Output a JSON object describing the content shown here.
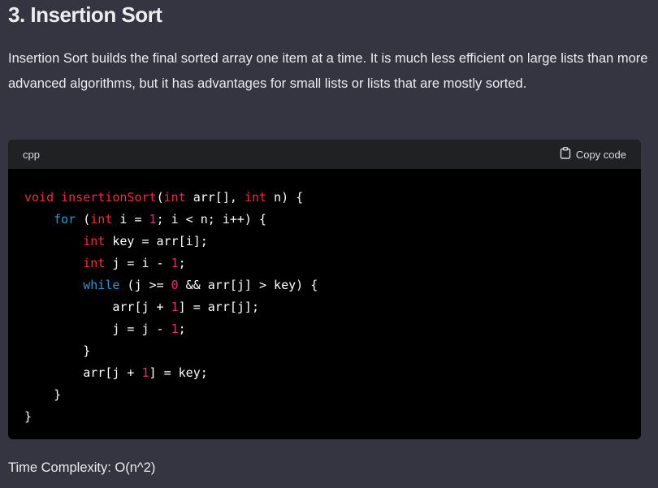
{
  "heading": "3. Insertion Sort",
  "paragraph": "Insertion Sort builds the final sorted array one item at a time. It is much less efficient on large lists than more advanced algorithms, but it has advantages for small lists or lists that are mostly sorted.",
  "code_block": {
    "language": "cpp",
    "copy_label": "Copy code",
    "copy_icon": "clipboard-icon",
    "colors": {
      "keyword": "#2e95d3",
      "type": "#f22c3d",
      "function": "#f22c3d",
      "number": "#df3079",
      "text": "#ffffff",
      "background": "#000000",
      "header_background": "#202123"
    },
    "lines": [
      [
        {
          "t": "type",
          "v": "void"
        },
        {
          "t": "plain",
          "v": " "
        },
        {
          "t": "function",
          "v": "insertionSort"
        },
        {
          "t": "plain",
          "v": "("
        },
        {
          "t": "type",
          "v": "int"
        },
        {
          "t": "plain",
          "v": " arr[], "
        },
        {
          "t": "type",
          "v": "int"
        },
        {
          "t": "plain",
          "v": " n) {"
        }
      ],
      [
        {
          "t": "plain",
          "v": "    "
        },
        {
          "t": "keyword",
          "v": "for"
        },
        {
          "t": "plain",
          "v": " ("
        },
        {
          "t": "type",
          "v": "int"
        },
        {
          "t": "plain",
          "v": " i = "
        },
        {
          "t": "number",
          "v": "1"
        },
        {
          "t": "plain",
          "v": "; i < n; i++) {"
        }
      ],
      [
        {
          "t": "plain",
          "v": "        "
        },
        {
          "t": "type",
          "v": "int"
        },
        {
          "t": "plain",
          "v": " key = arr[i];"
        }
      ],
      [
        {
          "t": "plain",
          "v": "        "
        },
        {
          "t": "type",
          "v": "int"
        },
        {
          "t": "plain",
          "v": " j = i - "
        },
        {
          "t": "number",
          "v": "1"
        },
        {
          "t": "plain",
          "v": ";"
        }
      ],
      [
        {
          "t": "plain",
          "v": "        "
        },
        {
          "t": "keyword",
          "v": "while"
        },
        {
          "t": "plain",
          "v": " (j >= "
        },
        {
          "t": "number",
          "v": "0"
        },
        {
          "t": "plain",
          "v": " && arr[j] > key) {"
        }
      ],
      [
        {
          "t": "plain",
          "v": "            arr[j + "
        },
        {
          "t": "number",
          "v": "1"
        },
        {
          "t": "plain",
          "v": "] = arr[j];"
        }
      ],
      [
        {
          "t": "plain",
          "v": "            j = j - "
        },
        {
          "t": "number",
          "v": "1"
        },
        {
          "t": "plain",
          "v": ";"
        }
      ],
      [
        {
          "t": "plain",
          "v": "        }"
        }
      ],
      [
        {
          "t": "plain",
          "v": "        arr[j + "
        },
        {
          "t": "number",
          "v": "1"
        },
        {
          "t": "plain",
          "v": "] = key;"
        }
      ],
      [
        {
          "t": "plain",
          "v": "    }"
        }
      ],
      [
        {
          "t": "plain",
          "v": "}"
        }
      ]
    ]
  },
  "footer_text": "Time Complexity: O(n^2)"
}
